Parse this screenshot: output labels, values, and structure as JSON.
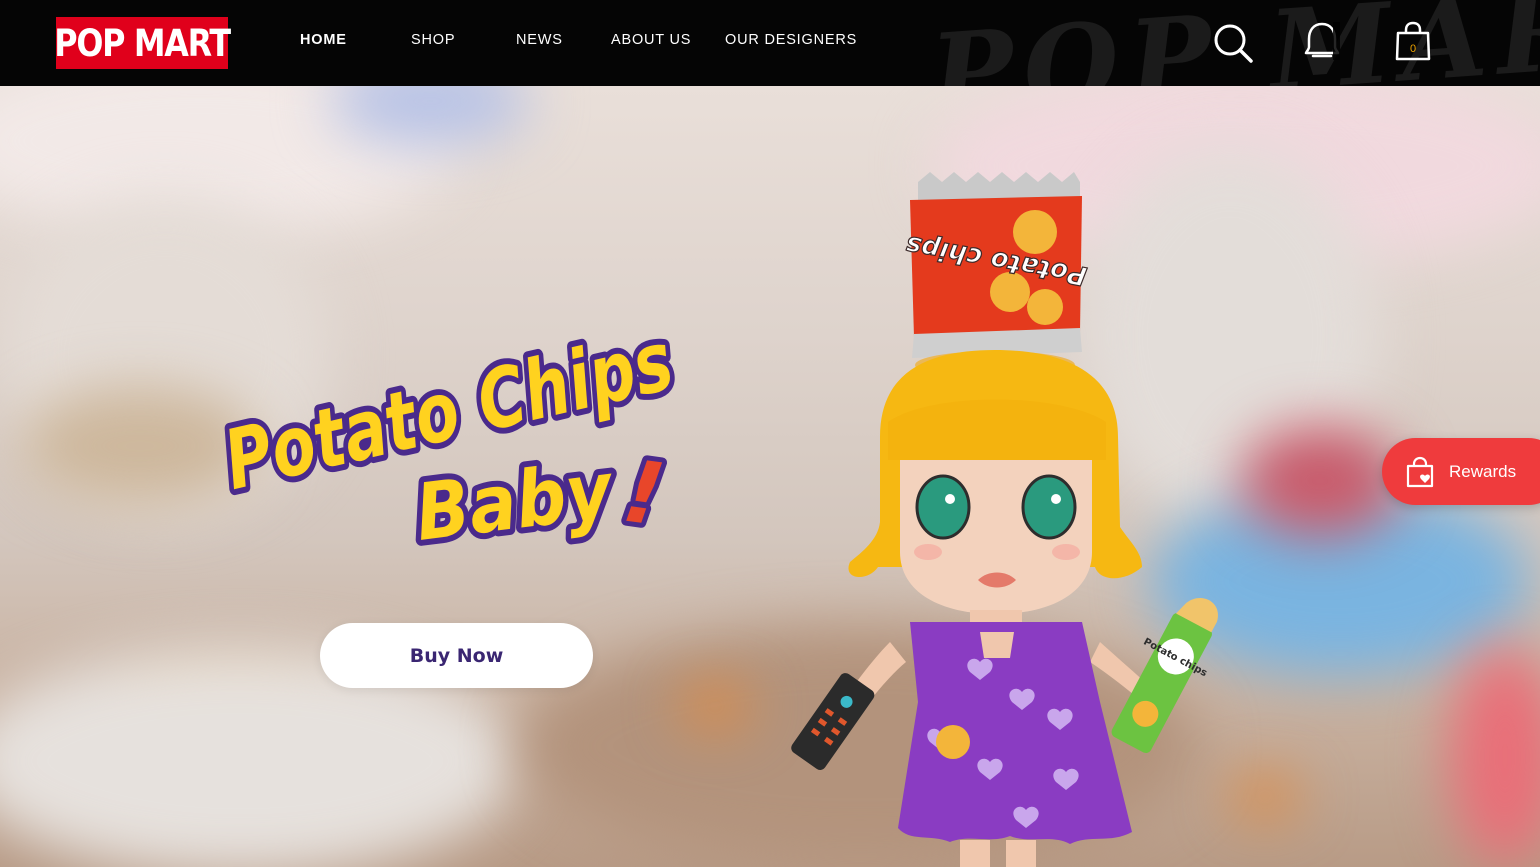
{
  "header": {
    "logo_text": "POP MART",
    "brand_color": "#e0001b",
    "background_color": "#050505",
    "nav": [
      {
        "label": "HOME",
        "active": true
      },
      {
        "label": "SHOP",
        "active": false
      },
      {
        "label": "NEWS",
        "active": false
      },
      {
        "label": "ABOUT US",
        "active": false
      },
      {
        "label": "OUR DESIGNERS",
        "active": false
      }
    ],
    "icons": [
      "search-icon",
      "account-icon",
      "cart-icon"
    ],
    "cart_count": "0",
    "cart_count_color": "#f0a500"
  },
  "hero": {
    "headline_line1": "Potato Chips",
    "headline_line2": "Baby",
    "headline_mark": "!",
    "headline_fill_color": "#ffd21f",
    "headline_outline_color": "#4a2a8c",
    "cta_label": "Buy Now",
    "chip_bag_text": "Potato chips",
    "chip_can_text": "Potato chips"
  },
  "rewards": {
    "label": "Rewards",
    "icon": "shopping-bag-heart-icon",
    "color": "#ef3b3d"
  }
}
